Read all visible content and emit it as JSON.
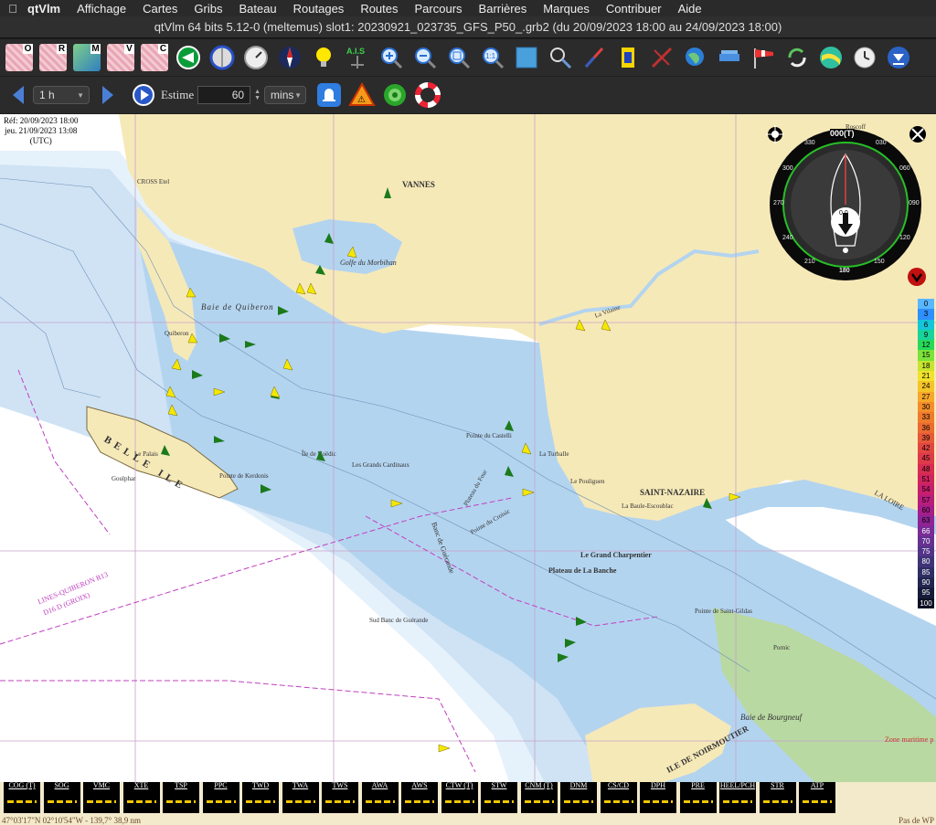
{
  "menubar": {
    "apple": "",
    "app": "qtVlm",
    "items": [
      "Affichage",
      "Cartes",
      "Gribs",
      "Bateau",
      "Routages",
      "Routes",
      "Parcours",
      "Barrières",
      "Marques",
      "Contribuer",
      "Aide"
    ]
  },
  "window": {
    "title": "qtVlm 64 bits 5.12-0 (meltemus) slot1: 20230921_023735_GFS_P50_.grb2 (du 20/09/2023 18:00 au 24/09/2023 18:00)"
  },
  "toolbar1": {
    "layer_buttons": [
      "O",
      "R",
      "M",
      "V",
      "C"
    ]
  },
  "toolbar2": {
    "step_value": "1 h",
    "estime_label": "Estime",
    "estime_value": "60",
    "estime_unit": "mins"
  },
  "map_info": {
    "ref": "Réf: 20/09/2023 18:00",
    "date": "jeu. 21/09/2023 13:08",
    "tz": "(UTC)"
  },
  "compass": {
    "heading": "000(T)",
    "ticks": [
      "330",
      "030",
      "300",
      "060",
      "270",
      "090",
      "240",
      "120",
      "210",
      "150",
      "180"
    ],
    "speed": "0.0"
  },
  "wind_scale": [
    "0",
    "3",
    "6",
    "9",
    "12",
    "15",
    "18",
    "21",
    "24",
    "27",
    "30",
    "33",
    "36",
    "39",
    "42",
    "45",
    "48",
    "51",
    "54",
    "57",
    "60",
    "63",
    "66",
    "70",
    "75",
    "80",
    "85",
    "90",
    "95",
    "100"
  ],
  "wind_colors": [
    "#5ab6ff",
    "#2e8fff",
    "#15c6d8",
    "#18d39a",
    "#27d95a",
    "#7be23a",
    "#c7e42e",
    "#f1e22a",
    "#f6c428",
    "#f7a829",
    "#f38e2b",
    "#ef7b2c",
    "#eb6b31",
    "#e7593a",
    "#e34642",
    "#de3a4a",
    "#d82c52",
    "#d0245e",
    "#c61f6d",
    "#b81d7d",
    "#a61d8b",
    "#8f2394",
    "#7a2b96",
    "#663191",
    "#533387",
    "#3f3377",
    "#2f2d63",
    "#22264f",
    "#171b3a",
    "#0d1024"
  ],
  "map_labels": {
    "vannes": "VANNES",
    "golfe": "Golfe du Morbihan",
    "baie_quiberon": "Baie de Quiberon",
    "belle_ile": "BELLE ILE",
    "saint_nazaire": "SAINT-NAZAIRE",
    "la_loire": "LA LOIRE",
    "ile_noirmoutier": "ILE DE NOIRMOUTIER",
    "baie_bourgneuf": "Baie de Bourgneuf",
    "plateau_four": "Plateau du Four",
    "grand_charpentier": "Le Grand Charpentier",
    "banche": "Plateau de La Banche",
    "pointe_croisic": "Pointe du Croisic",
    "la_turballe": "La Turballe",
    "pointe_castelli": "Pointe du Castelli",
    "quiberon": "Quiberon",
    "le_palais": "Le Palais",
    "lines": "LINES-QUIBERON R13",
    "lines2": "D16 D (GROIX)",
    "zone_maritime": "Zone maritime p",
    "pornic": "Pornic",
    "la_vilaine": "La Vilaine",
    "le_pouliguen": "Le Pouliguen",
    "la_baule": "La Baule-Escoublac",
    "pointe_st_gildas": "Pointe de Saint-Gildas",
    "crosse": "CROSS Etel",
    "roscoff": "Roscoff",
    "houat": "Les Grands Cardinaux",
    "hoedic": "Île de Hoëdic",
    "pointe_kerdonis": "Pointe de Kerdonis",
    "goulphar": "Goulphar",
    "banc_guerande": "Banc de Guérande",
    "sud_banc": "Sud Banc de Guérande"
  },
  "instruments": [
    "COG (T)",
    "SOG",
    "VMC",
    "XTE",
    "TSP",
    "PPC",
    "TWD",
    "TWA",
    "TWS",
    "AWA",
    "AWS",
    "CTW (T)",
    "STW",
    "CNM (T)",
    "DNM",
    "CS/CD",
    "DPH",
    "PRE",
    "HEEL/PCH",
    "STR",
    "ATP"
  ],
  "status": {
    "position": "47°03'17\"N 02°10'54\"W - 139,7° 38,9 nm",
    "right": "Pas de WP"
  }
}
